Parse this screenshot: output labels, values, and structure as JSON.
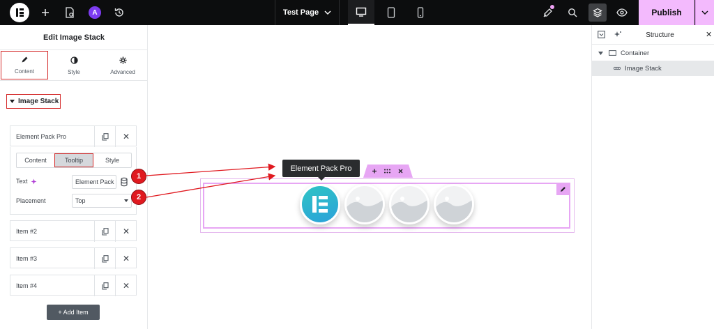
{
  "topbar": {
    "ai_badge_label": "A",
    "page_title": "Test Page",
    "publish_label": "Publish"
  },
  "left_panel": {
    "title": "Edit Image Stack",
    "tabs": [
      {
        "label": "Content",
        "icon": "pencil-icon"
      },
      {
        "label": "Style",
        "icon": "half-circle-icon"
      },
      {
        "label": "Advanced",
        "icon": "gear-icon"
      }
    ],
    "section_title": "Image Stack",
    "items": [
      {
        "label": "Element Pack Pro"
      },
      {
        "label": "Item #2"
      },
      {
        "label": "Item #3"
      },
      {
        "label": "Item #4"
      }
    ],
    "item_tabs": [
      {
        "label": "Content"
      },
      {
        "label": "Tooltip"
      },
      {
        "label": "Style"
      }
    ],
    "text_label": "Text",
    "text_value": "Element Pack Pro",
    "placement_label": "Placement",
    "placement_value": "Top",
    "add_item_label": "+ Add Item"
  },
  "canvas": {
    "tooltip_text": "Element Pack Pro",
    "markers": [
      "1",
      "2"
    ],
    "accent_color": "#e7a6f4",
    "annotation_color": "#e0191f"
  },
  "right_panel": {
    "title": "Structure",
    "tree": [
      {
        "label": "Container"
      },
      {
        "label": "Image Stack"
      }
    ]
  }
}
